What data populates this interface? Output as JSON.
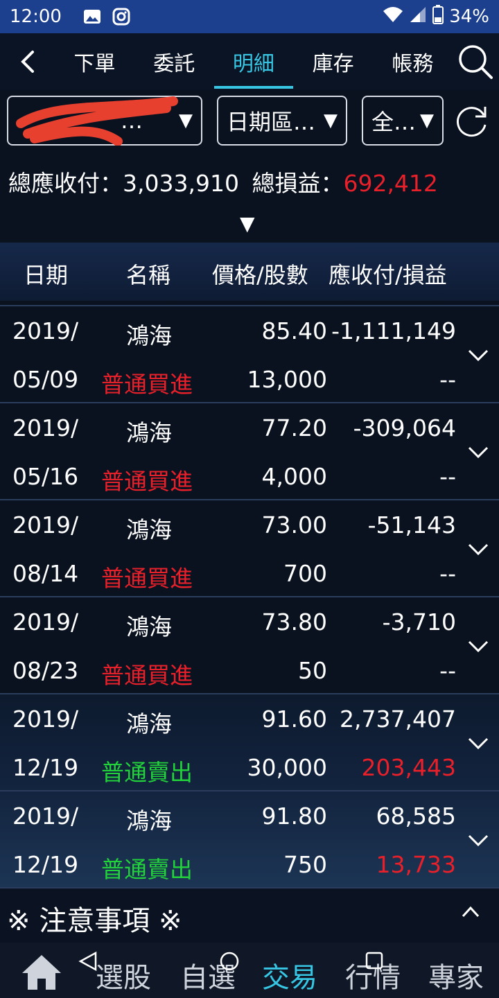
{
  "status_bar": {
    "time": "12:00",
    "battery": "34%"
  },
  "tabs": [
    {
      "label": "下單",
      "active": false
    },
    {
      "label": "委託",
      "active": false
    },
    {
      "label": "明細",
      "active": true
    },
    {
      "label": "庫存",
      "active": false
    },
    {
      "label": "帳務",
      "active": false
    }
  ],
  "filters": {
    "account_visible": "…",
    "date_range": "日期區…",
    "scope": "全…"
  },
  "summary": {
    "receivable_label": "總應收付：",
    "receivable_value": "3,033,910",
    "profit_label": "總損益：",
    "profit_value": "692,412"
  },
  "table": {
    "headers": [
      "日期",
      "名稱",
      "價格/股數",
      "應收付/損益"
    ],
    "rows": [
      {
        "year": "2019/",
        "date": "05/09",
        "name": "鴻海",
        "type": "普通買進",
        "side": "buy",
        "price": "85.40",
        "shares": "13,000",
        "amount": "-1,111,149",
        "pl": "--"
      },
      {
        "year": "2019/",
        "date": "05/16",
        "name": "鴻海",
        "type": "普通買進",
        "side": "buy",
        "price": "77.20",
        "shares": "4,000",
        "amount": "-309,064",
        "pl": "--"
      },
      {
        "year": "2019/",
        "date": "08/14",
        "name": "鴻海",
        "type": "普通買進",
        "side": "buy",
        "price": "73.00",
        "shares": "700",
        "amount": "-51,143",
        "pl": "--"
      },
      {
        "year": "2019/",
        "date": "08/23",
        "name": "鴻海",
        "type": "普通買進",
        "side": "buy",
        "price": "73.80",
        "shares": "50",
        "amount": "-3,710",
        "pl": "--"
      },
      {
        "year": "2019/",
        "date": "12/19",
        "name": "鴻海",
        "type": "普通賣出",
        "side": "sell",
        "price": "91.60",
        "shares": "30,000",
        "amount": "2,737,407",
        "pl": "203,443"
      },
      {
        "year": "2019/",
        "date": "12/19",
        "name": "鴻海",
        "type": "普通賣出",
        "side": "sell",
        "price": "91.80",
        "shares": "750",
        "amount": "68,585",
        "pl": "13,733"
      }
    ]
  },
  "notice": {
    "label": "※ 注意事項 ※"
  },
  "bottom_nav": [
    {
      "label": "選股",
      "active": false
    },
    {
      "label": "自選",
      "active": false
    },
    {
      "label": "交易",
      "active": true
    },
    {
      "label": "行情",
      "active": false
    },
    {
      "label": "專家",
      "active": false
    }
  ],
  "colors": {
    "accent": "#37c6e3",
    "loss_red": "#e8202a",
    "sell_green": "#22d23a",
    "status_bar": "#1c3f8e"
  },
  "icons": [
    "image-icon",
    "instagram-icon",
    "wifi-icon",
    "signal-icon",
    "battery-icon",
    "back-icon",
    "search-icon",
    "refresh-icon",
    "chevron-down-icon",
    "chevron-up-icon",
    "home-icon"
  ]
}
